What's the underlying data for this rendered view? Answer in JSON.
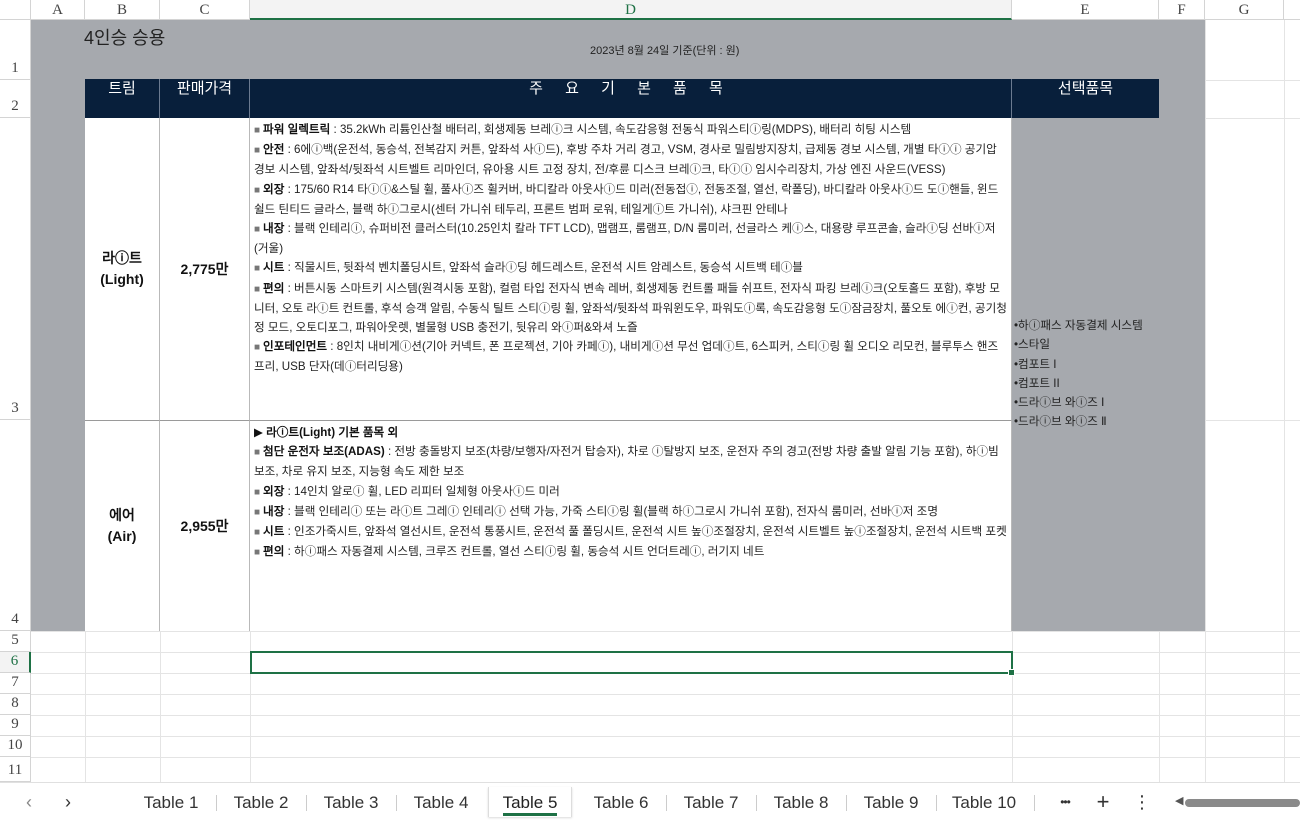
{
  "columns": [
    "A",
    "B",
    "C",
    "D",
    "E",
    "F",
    "G"
  ],
  "selected_column": "D",
  "rows": [
    "1",
    "2",
    "3",
    "4",
    "5",
    "6",
    "7",
    "8",
    "9",
    "10",
    "11"
  ],
  "selected_row": "6",
  "sheet": {
    "title": "4인승 승용",
    "date_note": "2023년 8월 24일 기준(단위 : 원)",
    "headers": {
      "trim": "트림",
      "price": "판매가격",
      "features": "주 요 기 본 품 목",
      "options": "선택품목"
    },
    "rows": [
      {
        "trim_name": "라ⓘ트",
        "trim_en": "(Light)",
        "price": "2,775만",
        "features": [
          {
            "label": "파워 일렉트릭",
            "text": " : 35.2kWh 리튬인산철 배터리, 회생제동 브레ⓘ크 시스템, 속도감응형 전동식 파워스티ⓘ링(MDPS), 배터리 히팅 시스템"
          },
          {
            "label": "안전",
            "text": " : 6에ⓘ백(운전석, 동승석, 전복감지 커튼, 앞좌석 사ⓘ드), 후방 주차 거리 경고, VSM, 경사로 밀림방지장치, 급제동 경보 시스템, 개별 타ⓘⓘ 공기압 경보 시스템, 앞좌석/뒷좌석 시트벨트 리마인더, 유아용 시트 고정 장치, 전/후륜 디스크 브레ⓘ크, 타ⓘⓘ 임시수리장치, 가상 엔진 사운드(VESS)"
          },
          {
            "label": "외장",
            "text": " : 175/60 R14 타ⓘⓘ&스틸 휠, 풀사ⓘ즈 휠커버, 바디칼라 아웃사ⓘ드 미러(전동접ⓘ, 전동조절, 열선, 락폴딩), 바디칼라 아웃사ⓘ드 도ⓘ핸들, 윈드쉴드 틴티드 글라스,                                      블랙 하ⓘ그로시(센터 가니쉬 테두리, 프론트 범퍼 로워, 테일게ⓘ트 가니쉬), 샤크핀 안테나"
          },
          {
            "label": "내장",
            "text": " : 블랙 인테리ⓘ, 슈퍼비전 클러스터(10.25인치 칼라 TFT LCD), 맵램프, 룸램프, D/N 룸미러, 선글라스 케ⓘ스, 대용량 루프콘솔, 슬라ⓘ딩 선바ⓘ저(거울)"
          },
          {
            "label": "시트",
            "text": " : 직물시트, 뒷좌석 벤치폴딩시트, 앞좌석 슬라ⓘ딩 헤드레스트, 운전석 시트 암레스트, 동승석 시트백 테ⓘ블"
          },
          {
            "label": "편의",
            "text": " : 버튼시동 스마트키 시스템(원격시동 포함), 컬럼 타입 전자식 변속 레버, 회생제동 컨트롤 패들 쉬프트,         전자식 파킹 브레ⓘ크(오토홀드 포함), 후방 모니터, 오토 라ⓘ트 컨트롤, 후석 승객 알림, 수동식 틸트 스티ⓘ링 휠, 앞좌석/뒷좌석 파워윈도우, 파워도ⓘ록, 속도감응형 도ⓘ잠금장치, 풀오토 에ⓘ컨, 공기청정 모드, 오토디포그, 파워아웃렛, 별물형 USB 충전기, 뒷유리 와ⓘ퍼&와셔 노즐"
          },
          {
            "label": "인포테인먼트",
            "text": " : 8인치 내비게ⓘ션(기아 커넥트, 폰 프로젝션, 기아 카페ⓘ), 내비게ⓘ션 무선 업데ⓘ트, 6스피커, 스티ⓘ링 휠 오디오 리모컨, 블루투스 핸즈프리, USB 단자(데ⓘ터리딩용)"
          }
        ]
      },
      {
        "trim_name": "에어",
        "trim_en": "(Air)",
        "price": "2,955만",
        "lead": "▶ 라ⓘ트(Light) 기본 품목 외",
        "features": [
          {
            "label": "첨단 운전자 보조(ADAS)",
            "text": " : 전방 충돌방지 보조(차량/보행자/자전거 탑승자), 차로 ⓘ탈방지 보조, 운전자 주의 경고(전방 차량 출발 알림 기능 포함), 하ⓘ빔 보조, 차로 유지 보조, 지능형 속도 제한 보조"
          },
          {
            "label": "외장",
            "text": " : 14인치 알로ⓘ 휠, LED 리피터 일체형 아웃사ⓘ드 미러"
          },
          {
            "label": "내장",
            "text": " : 블랙 인테리ⓘ 또는 라ⓘ트 그레ⓘ 인테리ⓘ 선택 가능, 가죽 스티ⓘ링 휠(블랙 하ⓘ그로시 가니쉬 포함), 전자식 룸미러, 선바ⓘ저 조명"
          },
          {
            "label": "시트",
            "text": " : 인조가죽시트, 앞좌석 열선시트, 운전석 통풍시트, 운전석 풀 폴딩시트, 운전석 시트 높ⓘ조절장치, 운전석 시트벨트 높ⓘ조절장치, 운전석 시트백 포켓"
          },
          {
            "label": "편의",
            "text": " : 하ⓘ패스 자동결제 시스템, 크루즈 컨트롤, 열선 스티ⓘ링 휠, 동승석 시트 언더트레ⓘ, 러기지 네트"
          }
        ]
      }
    ],
    "options": [
      "•하ⓘ패스 자동결제 시스템",
      "•스타일",
      "•컴포트 I",
      "•컴포트 II",
      "•드라ⓘ브 와ⓘ즈 Ⅰ",
      "•드라ⓘ브 와ⓘ즈 Ⅱ"
    ]
  },
  "tabs": [
    "Table 1",
    "Table 2",
    "Table 3",
    "Table 4",
    "Table 5",
    "Table 6",
    "Table 7",
    "Table 8",
    "Table 9",
    "Table 10"
  ],
  "active_tab": "Table 5",
  "toolbar": {
    "prev": "‹",
    "next": "›",
    "more": "•••",
    "add": "+",
    "menu": "⋮",
    "scroll_left": "◀"
  },
  "colors": {
    "accent": "#1e7145",
    "header_bg": "#081f3b",
    "frame_gray": "#a6a9ae"
  }
}
